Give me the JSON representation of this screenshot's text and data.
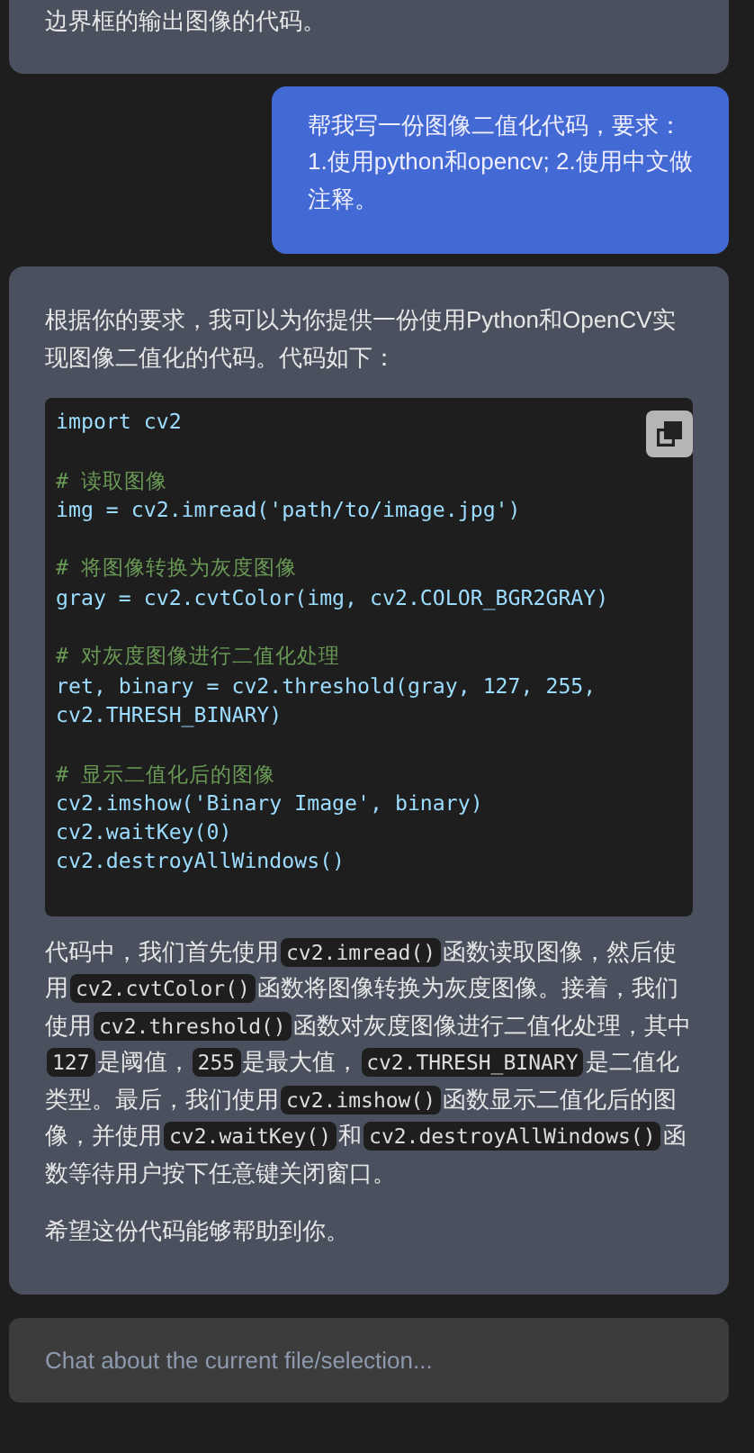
{
  "messages": [
    {
      "kind": "assistant",
      "paragraphs": [
        [
          {
            "kind": "text",
            "text": "边界框的输出图像的代码。"
          }
        ]
      ]
    },
    {
      "kind": "user",
      "paragraphs": [
        [
          {
            "kind": "text",
            "text": "帮我写一份图像二值化代码，要求：1.使用python和opencv; 2.使用中文做注释。"
          }
        ]
      ]
    },
    {
      "kind": "assistant",
      "intro": "根据你的要求，我可以为你提供一份使用Python和OpenCV实现图像二值化的代码。代码如下：",
      "code": [
        {
          "kind": "code",
          "text": "import cv2"
        },
        {
          "kind": "blank"
        },
        {
          "kind": "comment",
          "text": "# 读取图像"
        },
        {
          "kind": "code",
          "text": "img = cv2.imread('path/to/image.jpg')"
        },
        {
          "kind": "blank"
        },
        {
          "kind": "comment",
          "text": "# 将图像转换为灰度图像"
        },
        {
          "kind": "code",
          "text": "gray = cv2.cvtColor(img, cv2.COLOR_BGR2GRAY)"
        },
        {
          "kind": "blank"
        },
        {
          "kind": "comment",
          "text": "# 对灰度图像进行二值化处理"
        },
        {
          "kind": "code",
          "text": "ret, binary = cv2.threshold(gray, 127, 255,"
        },
        {
          "kind": "code",
          "text": "cv2.THRESH_BINARY)"
        },
        {
          "kind": "blank"
        },
        {
          "kind": "comment",
          "text": "# 显示二值化后的图像"
        },
        {
          "kind": "code",
          "text": "cv2.imshow('Binary Image', binary)"
        },
        {
          "kind": "code",
          "text": "cv2.waitKey(0)"
        },
        {
          "kind": "code",
          "text": "cv2.destroyAllWindows()"
        }
      ],
      "paragraphs": [
        [
          {
            "kind": "text",
            "text": "代码中，我们首先使用"
          },
          {
            "kind": "code",
            "text": "cv2.imread()"
          },
          {
            "kind": "text",
            "text": "函数读取图像，然后使用"
          },
          {
            "kind": "code",
            "text": "cv2.cvtColor()"
          },
          {
            "kind": "text",
            "text": "函数将图像转换为灰度图像。接着，我们使用"
          },
          {
            "kind": "code",
            "text": "cv2.threshold()"
          },
          {
            "kind": "text",
            "text": "函数对灰度图像进行二值化处理，其中"
          },
          {
            "kind": "code",
            "text": "127"
          },
          {
            "kind": "text",
            "text": "是阈值，"
          },
          {
            "kind": "code",
            "text": "255"
          },
          {
            "kind": "text",
            "text": "是最大值，"
          },
          {
            "kind": "code",
            "text": "cv2.THRESH_BINARY"
          },
          {
            "kind": "text",
            "text": "是二值化类型。最后，我们使用"
          },
          {
            "kind": "code",
            "text": "cv2.imshow()"
          },
          {
            "kind": "text",
            "text": "函数显示二值化后的图像，并使用"
          },
          {
            "kind": "code",
            "text": "cv2.waitKey()"
          },
          {
            "kind": "text",
            "text": "和"
          },
          {
            "kind": "code",
            "text": "cv2.destroyAllWindows()"
          },
          {
            "kind": "text",
            "text": "函数等待用户按下任意键关闭窗口。"
          }
        ],
        [
          {
            "kind": "text",
            "text": "希望这份代码能够帮助到你。"
          }
        ]
      ]
    }
  ],
  "input": {
    "placeholder": "Chat about the current file/selection..."
  }
}
